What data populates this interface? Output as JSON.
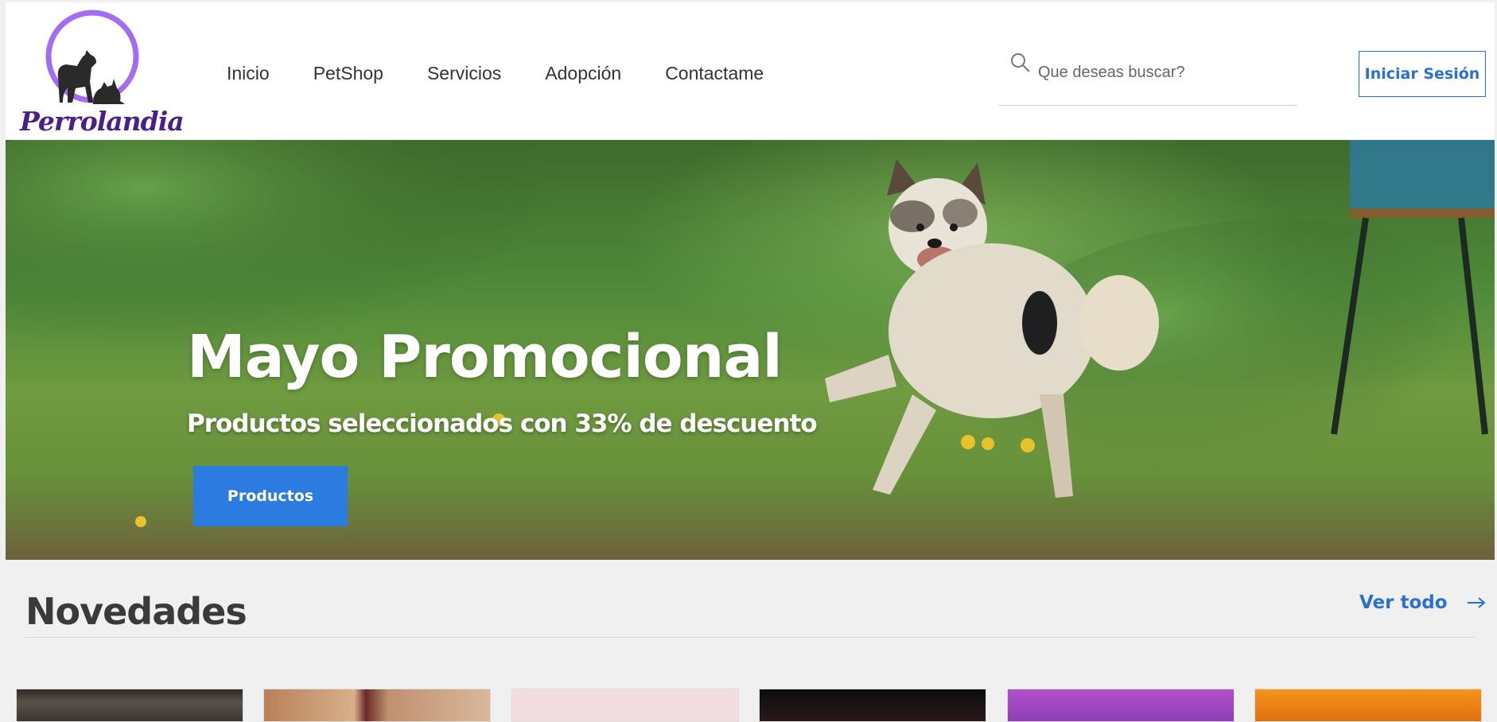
{
  "brand": {
    "name": "Perrolandia",
    "primary_color": "#2a6fd6",
    "logo_ring_color": "#a46cf0"
  },
  "nav": {
    "items": [
      {
        "label": "Inicio"
      },
      {
        "label": "PetShop"
      },
      {
        "label": "Servicios"
      },
      {
        "label": "Adopción"
      },
      {
        "label": "Contactame"
      }
    ]
  },
  "search": {
    "placeholder": "Que deseas buscar?",
    "value": "",
    "icon": "search-icon"
  },
  "login": {
    "label": "Iniciar Sesión"
  },
  "hero": {
    "title": "Mayo Promocional",
    "subtitle": "Productos seleccionados con 33% de descuento",
    "button_label": "Productos"
  },
  "novedades": {
    "title": "Novedades",
    "see_all_label": "Ver todo",
    "see_all_icon": "arrow-right-icon",
    "cards": [
      {
        "color": "#3a3530"
      },
      {
        "color": "#c09070"
      },
      {
        "color": "#f4dde2"
      },
      {
        "color": "#0c0c0e"
      },
      {
        "color": "#a84ac8"
      },
      {
        "color": "#f08a1a"
      }
    ]
  }
}
